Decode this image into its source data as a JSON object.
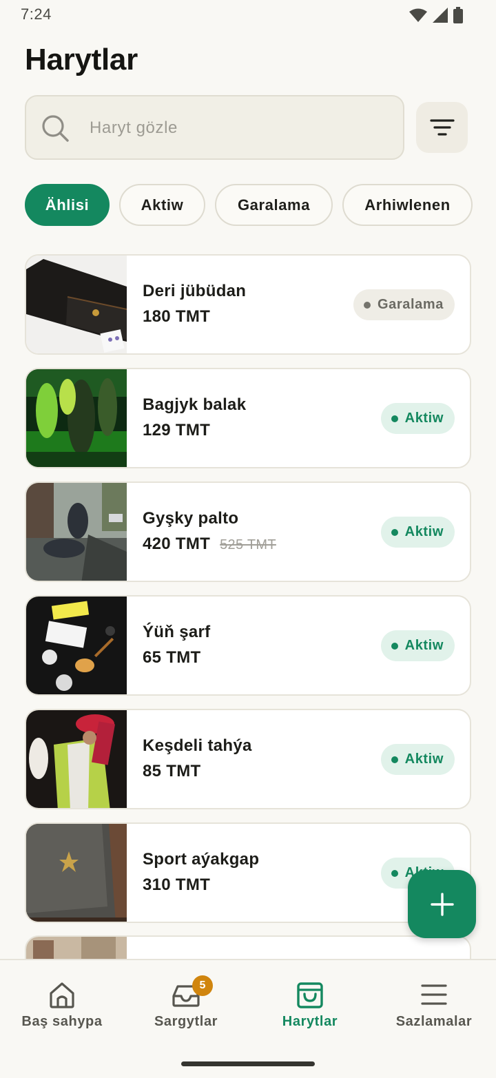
{
  "status_bar": {
    "time": "7:24"
  },
  "page_title": "Harytlar",
  "search": {
    "placeholder": "Haryt gözle",
    "value": ""
  },
  "filter_chips": [
    {
      "label": "Ählisi",
      "selected": true
    },
    {
      "label": "Aktiw",
      "selected": false
    },
    {
      "label": "Garalama",
      "selected": false
    },
    {
      "label": "Arhiwlenen",
      "selected": false
    }
  ],
  "products": [
    {
      "name": "Deri jübüdan",
      "price": "180 TMT",
      "old_price": "",
      "status": "Garalama",
      "status_type": "draft",
      "image": "wallet-photo"
    },
    {
      "name": "Bagjyk balak",
      "price": "129 TMT",
      "old_price": "",
      "status": "Aktiw",
      "status_type": "active",
      "image": "dance-floor-photo"
    },
    {
      "name": "Gyşky palto",
      "price": "420 TMT",
      "old_price": "525 TMT",
      "status": "Aktiw",
      "status_type": "active",
      "image": "street-statue-photo"
    },
    {
      "name": "Ýüň şarf",
      "price": "65 TMT",
      "old_price": "",
      "status": "Aktiw",
      "status_type": "active",
      "image": "stickers-guitar-photo"
    },
    {
      "name": "Keşdeli tahýa",
      "price": "85 TMT",
      "old_price": "",
      "status": "Aktiw",
      "status_type": "active",
      "image": "dancer-photo"
    },
    {
      "name": "Sport aýakgap",
      "price": "310 TMT",
      "old_price": "",
      "status": "Aktiw",
      "status_type": "active",
      "image": "shoe-box-photo"
    }
  ],
  "fab": {
    "icon": "plus-icon"
  },
  "bottom_nav": [
    {
      "label": "Baş sahypa",
      "icon": "home-icon",
      "active": false
    },
    {
      "label": "Sargytlar",
      "icon": "inbox-icon",
      "active": false,
      "badge": "5"
    },
    {
      "label": "Harytlar",
      "icon": "shopping-bag-icon",
      "active": true
    },
    {
      "label": "Sazlamalar",
      "icon": "menu-icon",
      "active": false
    }
  ],
  "colors": {
    "accent": "#14885f",
    "background": "#f9f8f4",
    "badge": "#d0850e",
    "active_badge_bg": "#e1f2ea",
    "draft_badge_bg": "#efede6"
  }
}
